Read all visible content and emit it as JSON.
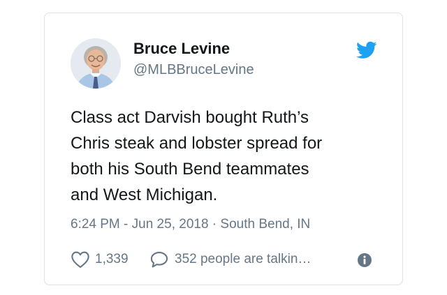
{
  "user": {
    "display_name": "Bruce Levine",
    "handle": "@MLBBruceLevine",
    "avatar_icon": "avatar-photo"
  },
  "tweet": {
    "text": "Class act Darvish  bought Ruth’s\nChris steak and lobster spread for\nboth his South Bend teammates\nand West Michigan.",
    "meta": "6:24 PM - Jun 25, 2018 · South Bend, IN"
  },
  "actions": {
    "likes": "1,339",
    "conversation": "352 people are talkin…"
  },
  "icons": {
    "brand": "twitter-bird-icon",
    "like": "heart-icon",
    "reply": "speech-bubble-icon",
    "info": "info-icon"
  },
  "colors": {
    "twitter_blue": "#1da1f2",
    "text": "#14171a",
    "secondary": "#657786",
    "border": "#dcdfe3"
  }
}
